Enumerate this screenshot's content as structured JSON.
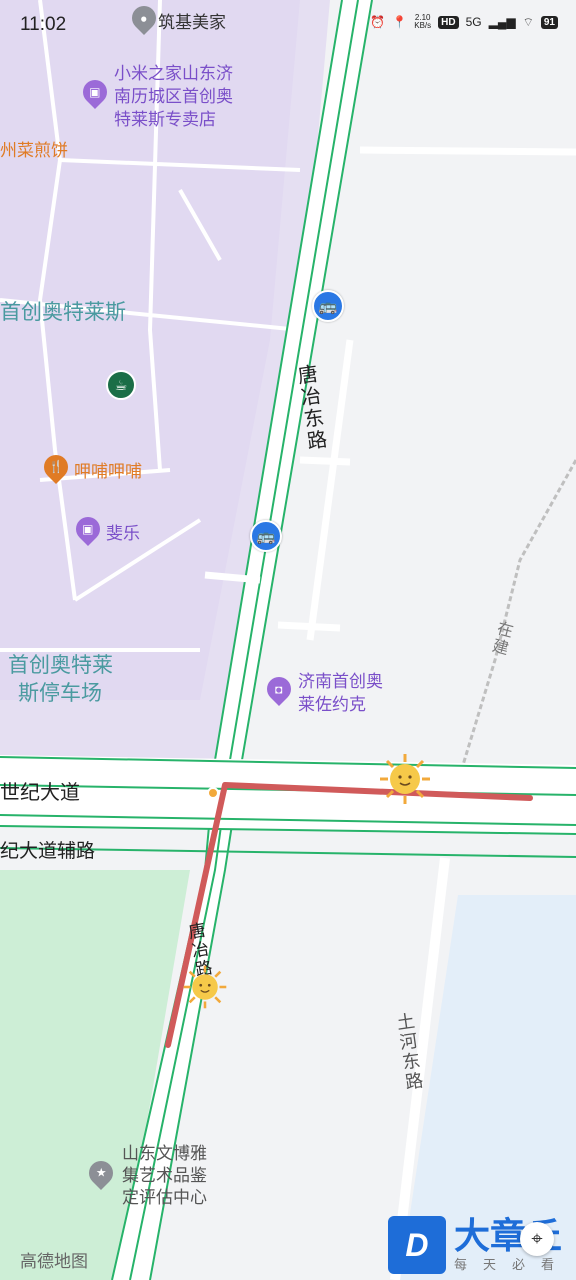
{
  "status_bar": {
    "time": "11:02",
    "net_speed_value": "2.10",
    "net_speed_unit": "KB/s",
    "hd": "HD",
    "network": "5G",
    "battery": "91"
  },
  "pois": {
    "zhuji": "筑基美家",
    "xiaomi_line1": "小米之家山东济",
    "xiaomi_line2": "南历城区首创奥",
    "xiaomi_line3": "特莱斯专卖店",
    "jianbing": "州菜煎饼",
    "outlets": "首创奥特莱斯",
    "bubu": "呷哺呷哺",
    "feile": "斐乐",
    "parking_line1": "首创奥特莱",
    "parking_line2": "斯停车场",
    "levis_line1": "济南首创奥",
    "levis_line2": "莱佐约克",
    "art_line1": "山东文博雅",
    "art_line2": "集艺术品鉴",
    "art_line3": "定评估中心"
  },
  "roads": {
    "tangye_north": "唐冶东路",
    "century": "世纪大道",
    "century_aux": "纪大道辅路",
    "tangye_south": "唐冶路",
    "tuhe": "土河东路",
    "zaijian": "在建"
  },
  "logos": {
    "amap": "高德地图",
    "watermark_main": "大章丘",
    "watermark_sub": "每天必看",
    "watermark_letter": "D"
  },
  "colors": {
    "route": "#d05a5a",
    "road_edge": "#27b36a",
    "mall": "#e5dff2",
    "park": "#cdeed6",
    "water": "#e3eef9"
  }
}
